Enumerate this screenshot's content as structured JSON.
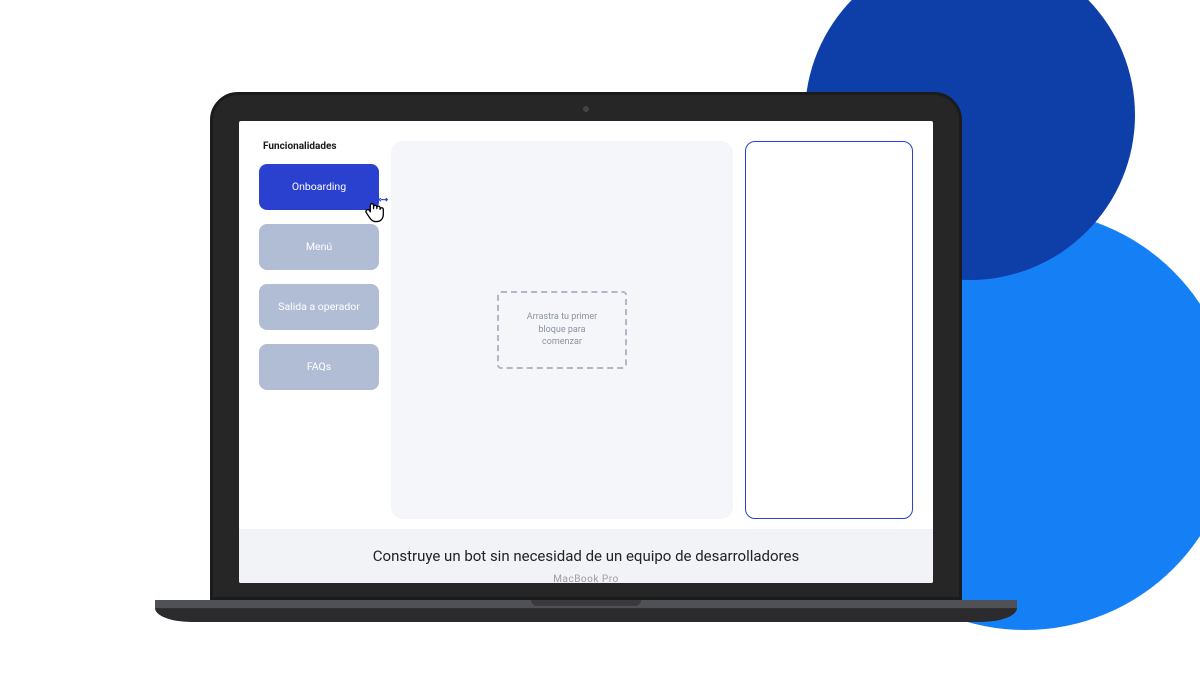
{
  "background": {
    "dark_circle_color": "#0e3fa8",
    "light_circle_color": "#1580f5"
  },
  "laptop": {
    "brand_text": "MacBook Pro"
  },
  "sidebar": {
    "title": "Funcionalidades",
    "blocks": [
      {
        "label": "Onboarding",
        "active": true
      },
      {
        "label": "Menú",
        "active": false
      },
      {
        "label": "Salida a operador",
        "active": false
      },
      {
        "label": "FAQs",
        "active": false
      }
    ]
  },
  "canvas": {
    "drop_hint": "Arrastra tu primer bloque para comenzar"
  },
  "footer": {
    "tagline": "Construye un bot sin necesidad de un equipo de desarrolladores"
  }
}
